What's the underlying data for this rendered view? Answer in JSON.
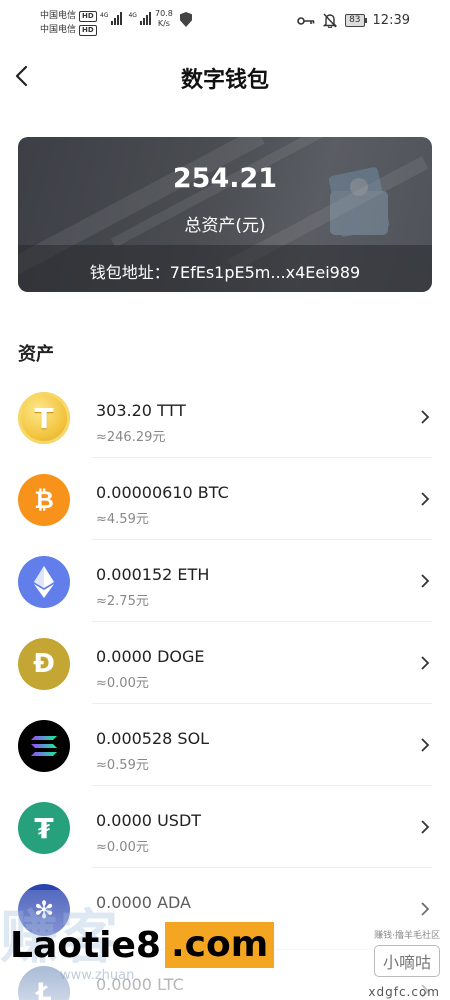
{
  "status_bar": {
    "carrier1": "中国电信",
    "carrier2": "中国电信",
    "hd": "HD",
    "net1": "4G",
    "net2": "4G",
    "speed_value": "70.8",
    "speed_unit": "K/s",
    "battery": "83",
    "time": "12:39"
  },
  "header": {
    "title": "数字钱包"
  },
  "wallet_card": {
    "total": "254.21",
    "total_label": "总资产(元)",
    "address_label": "钱包地址：",
    "address": "7EfEs1pE5m...x4Eei989"
  },
  "section": {
    "title": "资产"
  },
  "assets": [
    {
      "amount": "303.20 TTT",
      "value": "≈246.29元",
      "icon": "ttt-coin-icon",
      "color": "#f2c23c",
      "glyph": "T"
    },
    {
      "amount": "0.00000610 BTC",
      "value": "≈4.59元",
      "icon": "bitcoin-icon",
      "color": "#f7931a",
      "glyph": "₿"
    },
    {
      "amount": "0.000152 ETH",
      "value": "≈2.75元",
      "icon": "ethereum-icon",
      "color": "#627eea",
      "glyph": "◆"
    },
    {
      "amount": "0.0000 DOGE",
      "value": "≈0.00元",
      "icon": "dogecoin-icon",
      "color": "#c3a634",
      "glyph": "Ð"
    },
    {
      "amount": "0.000528 SOL",
      "value": "≈0.59元",
      "icon": "solana-icon",
      "color": "#000000",
      "glyph": "≡"
    },
    {
      "amount": "0.0000 USDT",
      "value": "≈0.00元",
      "icon": "tether-icon",
      "color": "#26a17b",
      "glyph": "₮"
    },
    {
      "amount": "0.0000 ADA",
      "value": "",
      "icon": "cardano-icon",
      "color": "#2a44b0",
      "glyph": "✻"
    },
    {
      "amount": "0.0000 LTC",
      "value": "",
      "icon": "litecoin-icon",
      "color": "#345d9d",
      "glyph": "Ł"
    }
  ],
  "watermarks": {
    "main_text": "Laotie8",
    "main_suffix": ".com",
    "left_bg_text": "赚客",
    "left_url": "www.zhuan",
    "right_small": "赚钱·撸羊毛社区",
    "right_box": "小嘀咕",
    "right_site": "xdgfc.com"
  }
}
